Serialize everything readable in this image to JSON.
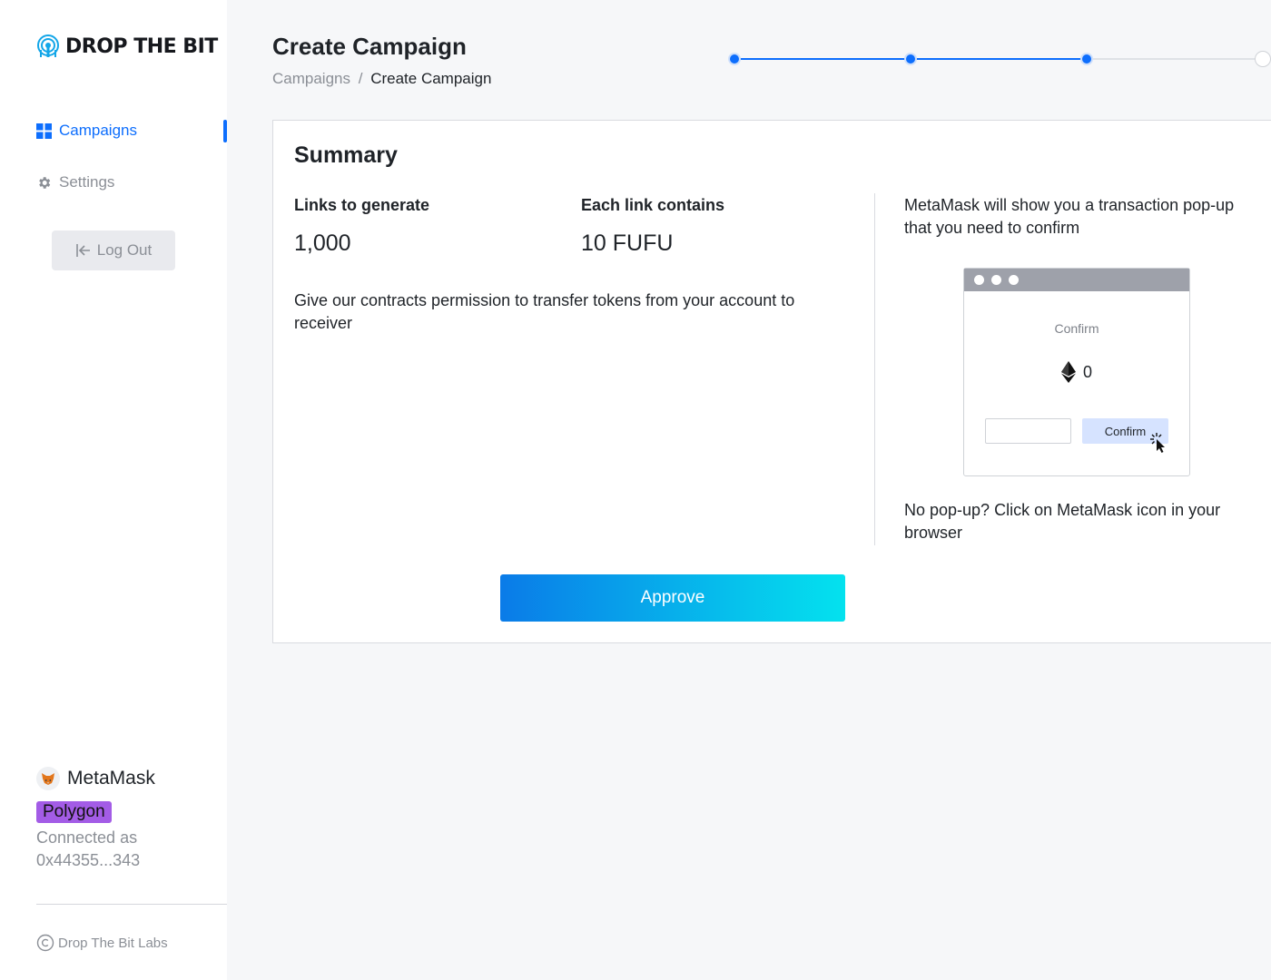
{
  "brand": {
    "name": "DROP THE BIT"
  },
  "nav": {
    "items": [
      {
        "label": "Campaigns",
        "icon": "grid-icon",
        "active": true
      },
      {
        "label": "Settings",
        "icon": "gear-icon",
        "active": false
      }
    ],
    "logout_label": "Log Out"
  },
  "wallet": {
    "name": "MetaMask",
    "network": "Polygon",
    "connected_label": "Connected as",
    "address": "0x44355...343"
  },
  "footer": {
    "copyright": "Drop The Bit Labs"
  },
  "header": {
    "title": "Create Campaign",
    "breadcrumb": {
      "parent": "Campaigns",
      "separator": "/",
      "current": "Create Campaign"
    }
  },
  "stepper": {
    "total_steps": 4,
    "completed_steps": 3
  },
  "summary": {
    "title": "Summary",
    "links_label": "Links to generate",
    "links_value": "1,000",
    "each_label": "Each link contains",
    "each_value": "10 FUFU",
    "permission_text": "Give our contracts permission to transfer tokens from your account to receiver",
    "metamask_info": "MetaMask will show you a transaction pop-up that you need to confirm",
    "mock": {
      "confirm_label": "Confirm",
      "amount": "0",
      "button_label": "Confirm"
    },
    "hint": "No pop-up? Click on MetaMask icon in your browser",
    "approve_label": "Approve"
  },
  "colors": {
    "accent": "#0d6efd",
    "network_badge": "#a35ce6",
    "approve_start": "#0a7be8",
    "approve_end": "#04e2ee"
  }
}
